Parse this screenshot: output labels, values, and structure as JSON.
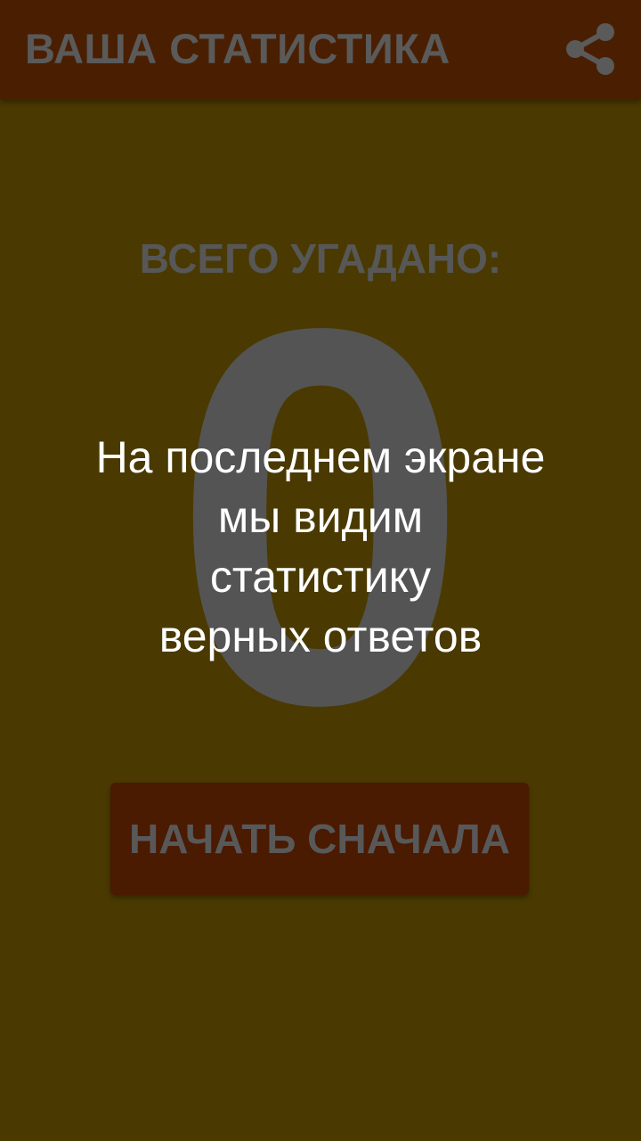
{
  "app_bar": {
    "title": "ВАША СТАТИСТИКА",
    "share_icon": "share-icon"
  },
  "stats": {
    "label": "ВСЕГО УГАДАНО:",
    "value": "0"
  },
  "actions": {
    "restart_label": "НАЧАТЬ СНАЧАЛА"
  },
  "overlay": {
    "lines": [
      "На последнем экране",
      "мы видим",
      "статистику",
      "верных ответов"
    ]
  },
  "colors": {
    "background": "#4a3a01",
    "app_bar": "#4a1f01",
    "button": "#4a1a01",
    "muted_text": "#575757",
    "overlay_text": "#ffffff"
  }
}
